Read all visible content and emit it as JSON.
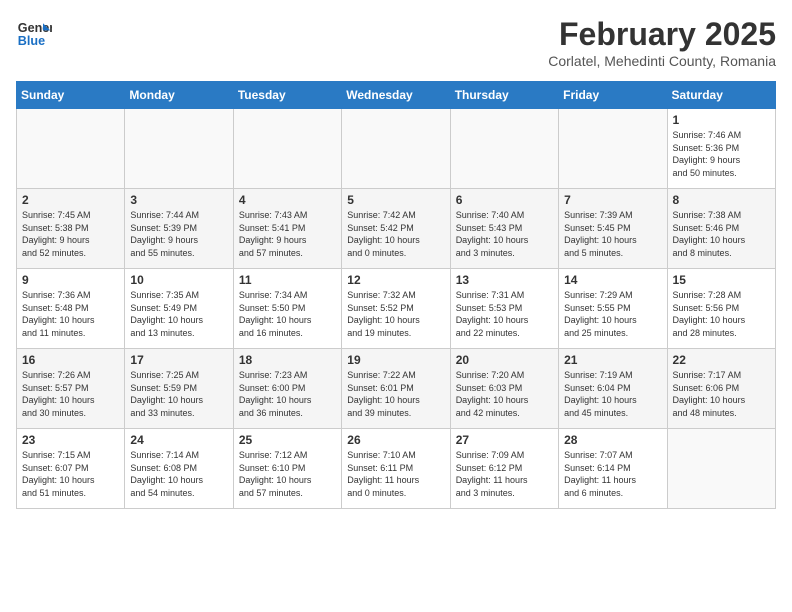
{
  "header": {
    "logo_line1": "General",
    "logo_line2": "Blue",
    "month": "February 2025",
    "location": "Corlatel, Mehedinti County, Romania"
  },
  "weekdays": [
    "Sunday",
    "Monday",
    "Tuesday",
    "Wednesday",
    "Thursday",
    "Friday",
    "Saturday"
  ],
  "weeks": [
    [
      {
        "day": "",
        "info": ""
      },
      {
        "day": "",
        "info": ""
      },
      {
        "day": "",
        "info": ""
      },
      {
        "day": "",
        "info": ""
      },
      {
        "day": "",
        "info": ""
      },
      {
        "day": "",
        "info": ""
      },
      {
        "day": "1",
        "info": "Sunrise: 7:46 AM\nSunset: 5:36 PM\nDaylight: 9 hours\nand 50 minutes."
      }
    ],
    [
      {
        "day": "2",
        "info": "Sunrise: 7:45 AM\nSunset: 5:38 PM\nDaylight: 9 hours\nand 52 minutes."
      },
      {
        "day": "3",
        "info": "Sunrise: 7:44 AM\nSunset: 5:39 PM\nDaylight: 9 hours\nand 55 minutes."
      },
      {
        "day": "4",
        "info": "Sunrise: 7:43 AM\nSunset: 5:41 PM\nDaylight: 9 hours\nand 57 minutes."
      },
      {
        "day": "5",
        "info": "Sunrise: 7:42 AM\nSunset: 5:42 PM\nDaylight: 10 hours\nand 0 minutes."
      },
      {
        "day": "6",
        "info": "Sunrise: 7:40 AM\nSunset: 5:43 PM\nDaylight: 10 hours\nand 3 minutes."
      },
      {
        "day": "7",
        "info": "Sunrise: 7:39 AM\nSunset: 5:45 PM\nDaylight: 10 hours\nand 5 minutes."
      },
      {
        "day": "8",
        "info": "Sunrise: 7:38 AM\nSunset: 5:46 PM\nDaylight: 10 hours\nand 8 minutes."
      }
    ],
    [
      {
        "day": "9",
        "info": "Sunrise: 7:36 AM\nSunset: 5:48 PM\nDaylight: 10 hours\nand 11 minutes."
      },
      {
        "day": "10",
        "info": "Sunrise: 7:35 AM\nSunset: 5:49 PM\nDaylight: 10 hours\nand 13 minutes."
      },
      {
        "day": "11",
        "info": "Sunrise: 7:34 AM\nSunset: 5:50 PM\nDaylight: 10 hours\nand 16 minutes."
      },
      {
        "day": "12",
        "info": "Sunrise: 7:32 AM\nSunset: 5:52 PM\nDaylight: 10 hours\nand 19 minutes."
      },
      {
        "day": "13",
        "info": "Sunrise: 7:31 AM\nSunset: 5:53 PM\nDaylight: 10 hours\nand 22 minutes."
      },
      {
        "day": "14",
        "info": "Sunrise: 7:29 AM\nSunset: 5:55 PM\nDaylight: 10 hours\nand 25 minutes."
      },
      {
        "day": "15",
        "info": "Sunrise: 7:28 AM\nSunset: 5:56 PM\nDaylight: 10 hours\nand 28 minutes."
      }
    ],
    [
      {
        "day": "16",
        "info": "Sunrise: 7:26 AM\nSunset: 5:57 PM\nDaylight: 10 hours\nand 30 minutes."
      },
      {
        "day": "17",
        "info": "Sunrise: 7:25 AM\nSunset: 5:59 PM\nDaylight: 10 hours\nand 33 minutes."
      },
      {
        "day": "18",
        "info": "Sunrise: 7:23 AM\nSunset: 6:00 PM\nDaylight: 10 hours\nand 36 minutes."
      },
      {
        "day": "19",
        "info": "Sunrise: 7:22 AM\nSunset: 6:01 PM\nDaylight: 10 hours\nand 39 minutes."
      },
      {
        "day": "20",
        "info": "Sunrise: 7:20 AM\nSunset: 6:03 PM\nDaylight: 10 hours\nand 42 minutes."
      },
      {
        "day": "21",
        "info": "Sunrise: 7:19 AM\nSunset: 6:04 PM\nDaylight: 10 hours\nand 45 minutes."
      },
      {
        "day": "22",
        "info": "Sunrise: 7:17 AM\nSunset: 6:06 PM\nDaylight: 10 hours\nand 48 minutes."
      }
    ],
    [
      {
        "day": "23",
        "info": "Sunrise: 7:15 AM\nSunset: 6:07 PM\nDaylight: 10 hours\nand 51 minutes."
      },
      {
        "day": "24",
        "info": "Sunrise: 7:14 AM\nSunset: 6:08 PM\nDaylight: 10 hours\nand 54 minutes."
      },
      {
        "day": "25",
        "info": "Sunrise: 7:12 AM\nSunset: 6:10 PM\nDaylight: 10 hours\nand 57 minutes."
      },
      {
        "day": "26",
        "info": "Sunrise: 7:10 AM\nSunset: 6:11 PM\nDaylight: 11 hours\nand 0 minutes."
      },
      {
        "day": "27",
        "info": "Sunrise: 7:09 AM\nSunset: 6:12 PM\nDaylight: 11 hours\nand 3 minutes."
      },
      {
        "day": "28",
        "info": "Sunrise: 7:07 AM\nSunset: 6:14 PM\nDaylight: 11 hours\nand 6 minutes."
      },
      {
        "day": "",
        "info": ""
      }
    ]
  ]
}
